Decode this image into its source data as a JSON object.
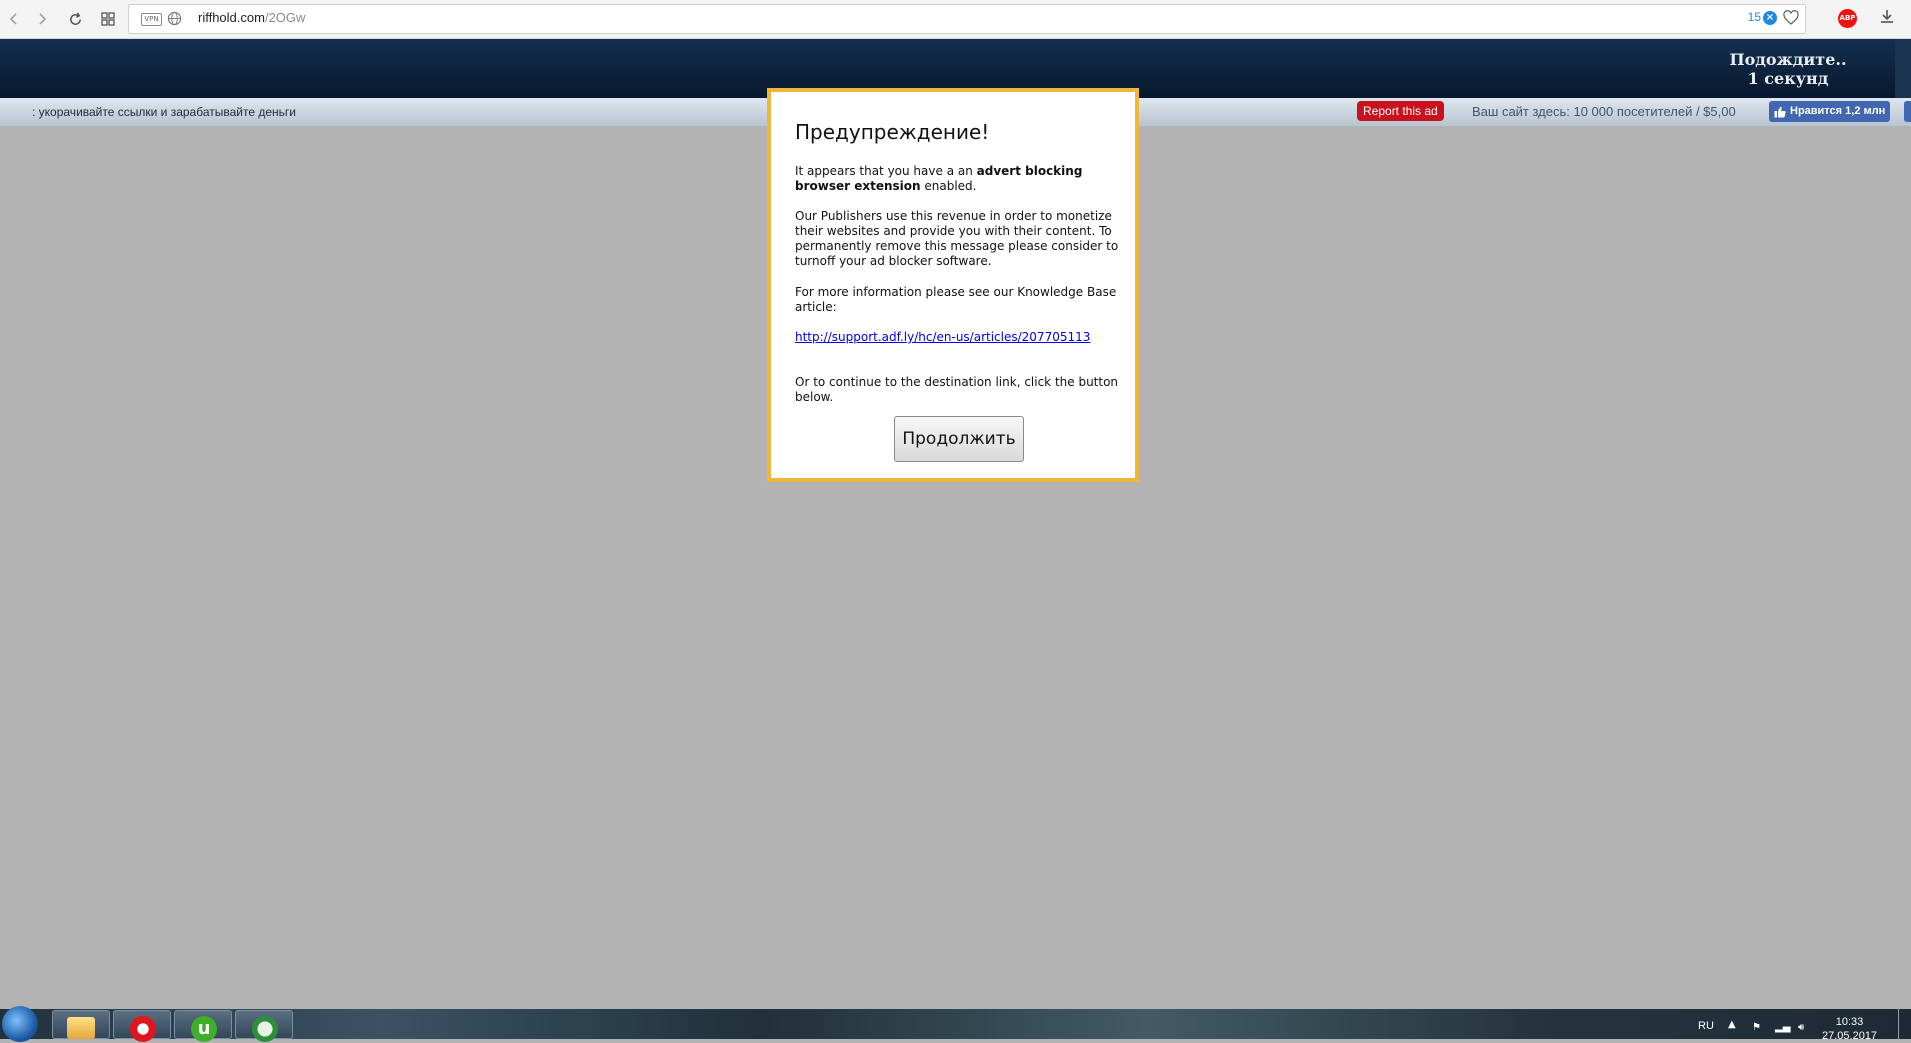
{
  "browser": {
    "url_host": "riffhold.com",
    "url_path": "/2OGw",
    "vpn_label": "VPN",
    "tab_count": "15",
    "abp_label": "ABP"
  },
  "header": {
    "wait_line1": "Подождите..",
    "wait_line2": "1 секунд"
  },
  "strip": {
    "tagline": ": укорачивайте ссылки и зарабатывайте деньги",
    "report_ad": "Report this ad",
    "ad_offer": "Ваш сайт здесь: 10 000 посетителей / $5,00",
    "like_label": "Нравится 1,2 млн"
  },
  "modal": {
    "title": "Предупреждение!",
    "p1_pre": "It appears that you have a an ",
    "p1_bold": "advert blocking browser extension",
    "p1_post": " enabled.",
    "p2": "Our Publishers use this revenue in order to monetize their websites and provide you with their content. To permanently remove this message please consider to turnoff your ad blocker software.",
    "p3": "For more information please see our Knowledge Base article:",
    "link": "http://support.adf.ly/hc/en-us/articles/207705113",
    "p4": "Or to continue to the destination link, click the button below.",
    "continue_label": "Продолжить"
  },
  "taskbar": {
    "language": "RU",
    "time": "10:33",
    "date": "27.05.2017"
  },
  "colors": {
    "modal_border": "#f0b63a",
    "report_red": "#c8121d",
    "fb_blue": "#4267b2",
    "header_navy": "#07182e"
  },
  "icons": [
    "back-icon",
    "forward-icon",
    "reload-icon",
    "tiles-icon",
    "globe-icon",
    "heart-icon",
    "download-icon",
    "thumbs-up-icon",
    "windows-start-icon",
    "folder-icon",
    "opera-icon",
    "utorrent-icon",
    "network-meter-icon"
  ]
}
